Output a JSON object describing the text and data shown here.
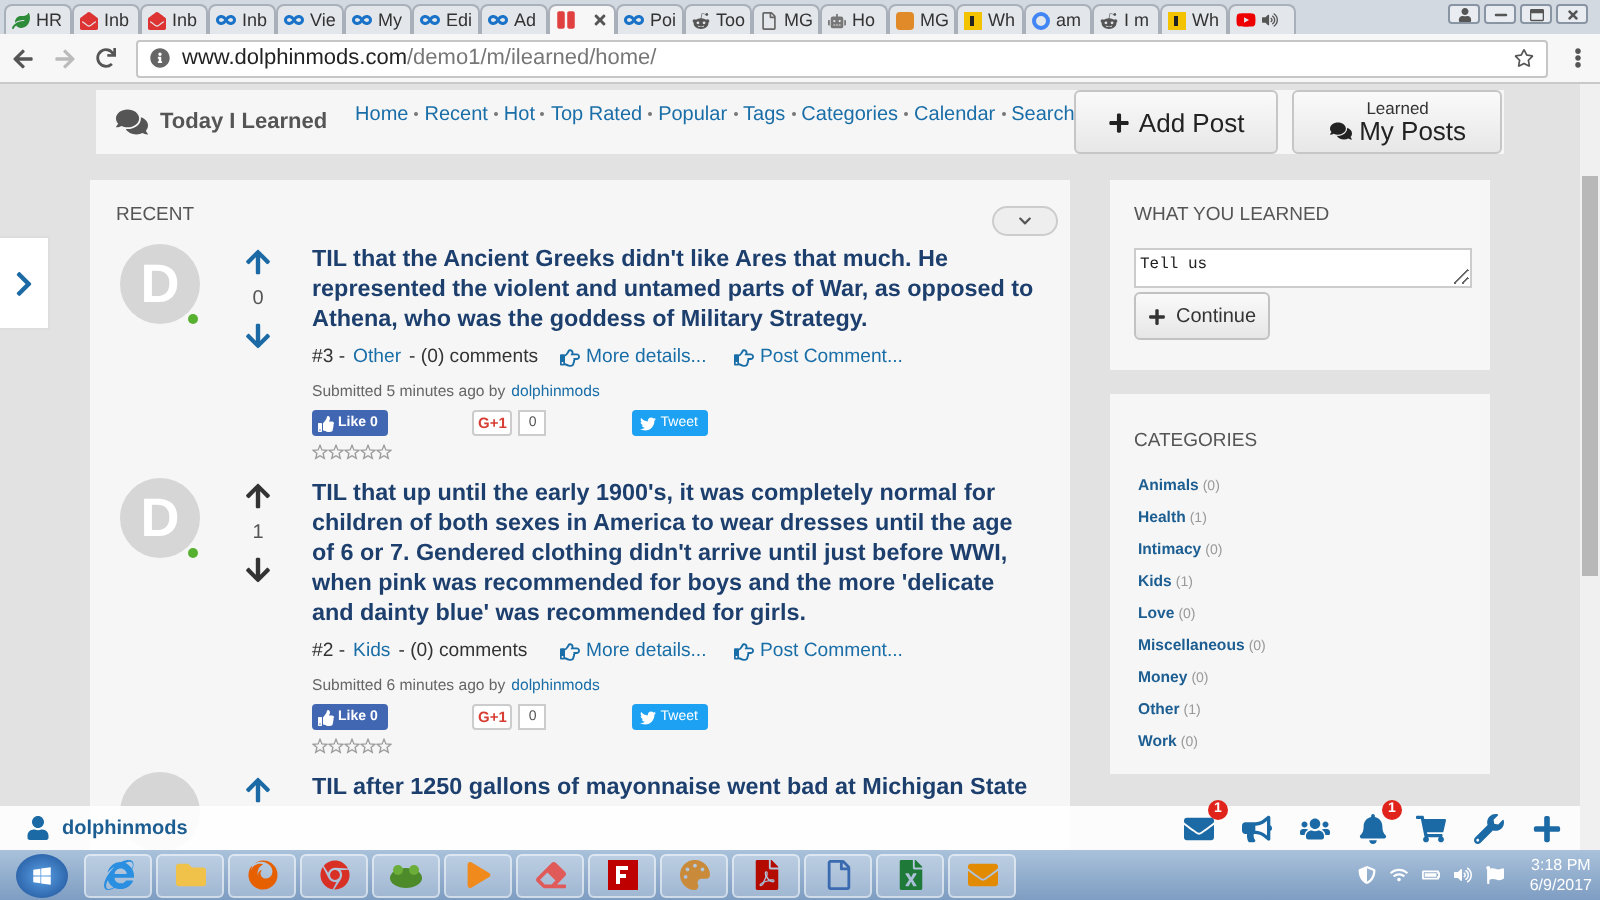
{
  "browser": {
    "tabs": [
      {
        "title": "HR",
        "kind": "leaf",
        "selected": false
      },
      {
        "title": "Inb",
        "kind": "mail",
        "selected": false
      },
      {
        "title": "Inb",
        "kind": "mail",
        "selected": false
      },
      {
        "title": "Inb",
        "kind": "link",
        "selected": false
      },
      {
        "title": "Vie",
        "kind": "link",
        "selected": false
      },
      {
        "title": "My",
        "kind": "link",
        "selected": false
      },
      {
        "title": "Edi",
        "kind": "link",
        "selected": false
      },
      {
        "title": "Ad",
        "kind": "link",
        "selected": false
      },
      {
        "kind": "pause",
        "selected": true
      },
      {
        "title": "Poi",
        "kind": "link",
        "selected": false
      },
      {
        "title": "Too",
        "kind": "alien",
        "selected": false
      },
      {
        "title": "MG",
        "kind": "page",
        "selected": false
      },
      {
        "title": "Ho",
        "kind": "robot",
        "selected": false
      },
      {
        "title": "MG",
        "kind": "m",
        "selected": false
      },
      {
        "title": "Wh",
        "kind": "l",
        "selected": false
      },
      {
        "title": "am",
        "kind": "g",
        "selected": false
      },
      {
        "title": "I m",
        "kind": "alien",
        "selected": false
      },
      {
        "title": "Wh",
        "kind": "l",
        "selected": false
      },
      {
        "kind": "video",
        "selected": false,
        "audio": true
      }
    ],
    "url_host": "www.dolphinmods.com",
    "url_path": "/demo1/m/ilearned/home/"
  },
  "site": {
    "title": "Today I Learned",
    "nav": [
      "Home",
      "Recent",
      "Hot",
      "Top Rated",
      "Popular",
      "Tags",
      "Categories",
      "Calendar",
      "Search"
    ],
    "add_button": "Add Post",
    "posts_caption": "Learned",
    "posts_button": "My Posts"
  },
  "feed": {
    "heading": "RECENT",
    "posts": [
      {
        "avatar": "D",
        "online": true,
        "votes": "0",
        "vote_active": true,
        "title": "TIL that the Ancient Greeks didn't like Ares that much. He represented the violent and untamed parts of War, as opposed to Athena, who was the goddess of Military Strategy.",
        "number": "#3 -",
        "category": "Other",
        "comments": "- (0) comments",
        "more": "More details...",
        "comment": "Post Comment...",
        "submitted": "Submitted 5 minutes ago by",
        "author": "dolphinmods",
        "like": "Like 0",
        "gplus": "G+1",
        "gplus_count": "0",
        "tweet": "Tweet",
        "stars": 0
      },
      {
        "avatar": "D",
        "online": true,
        "votes": "1",
        "vote_active": false,
        "title": "TIL that up until the early 1900's, it was completely normal for children of both sexes in America to wear dresses until the age of 6 or 7. Gendered clothing didn't arrive until just before WWI, when pink was recommended for boys and the more 'delicate and dainty blue' was recommended for girls.",
        "number": "#2 -",
        "category": "Kids",
        "comments": "- (0) comments",
        "more": "More details...",
        "comment": "Post Comment...",
        "submitted": "Submitted 6 minutes ago by",
        "author": "dolphinmods",
        "like": "Like 0",
        "gplus": "G+1",
        "gplus_count": "0",
        "tweet": "Tweet",
        "stars": 0
      }
    ],
    "partial_post": {
      "title": "TIL after 1250 gallons of mayonnaise went bad at Michigan State"
    }
  },
  "sidebar": {
    "learn": {
      "heading": "WHAT YOU LEARNED",
      "value": "Tell us",
      "button": "Continue"
    },
    "categories": {
      "heading": "CATEGORIES",
      "items": [
        {
          "name": "Animals",
          "count": "(0)"
        },
        {
          "name": "Health",
          "count": "(1)"
        },
        {
          "name": "Intimacy",
          "count": "(0)"
        },
        {
          "name": "Kids",
          "count": "(1)"
        },
        {
          "name": "Love",
          "count": "(0)"
        },
        {
          "name": "Miscellaneous",
          "count": "(0)"
        },
        {
          "name": "Money",
          "count": "(0)"
        },
        {
          "name": "Other",
          "count": "(1)"
        },
        {
          "name": "Work",
          "count": "(0)"
        }
      ]
    }
  },
  "bottom_bar": {
    "user": "dolphinmods",
    "icons": [
      {
        "kind": "mail",
        "badge": "1"
      },
      {
        "kind": "megaphone"
      },
      {
        "kind": "users"
      },
      {
        "kind": "bell",
        "badge": "1"
      },
      {
        "kind": "cart"
      },
      {
        "kind": "wrench"
      },
      {
        "kind": "plus"
      }
    ]
  },
  "taskbar": {
    "apps": [
      {
        "kind": "ie"
      },
      {
        "kind": "folder"
      },
      {
        "kind": "firefox"
      },
      {
        "kind": "chrome"
      },
      {
        "kind": "frog"
      },
      {
        "kind": "media"
      },
      {
        "kind": "eraser"
      },
      {
        "kind": "filezilla"
      },
      {
        "kind": "paint"
      },
      {
        "kind": "acrobat"
      },
      {
        "kind": "ab"
      },
      {
        "kind": "excel"
      },
      {
        "kind": "outlook"
      }
    ],
    "time": "3:18 PM",
    "date": "6/9/2017"
  }
}
